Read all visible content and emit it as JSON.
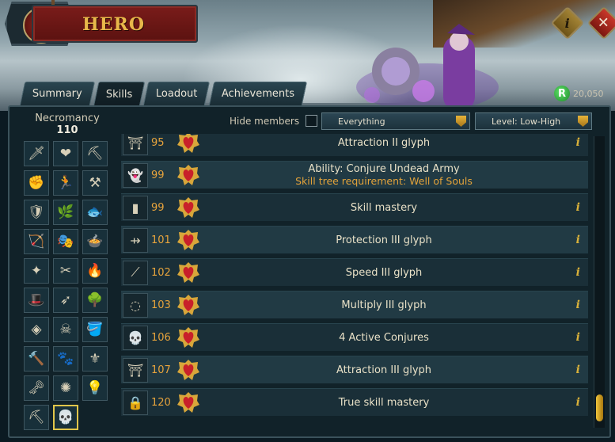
{
  "header": {
    "title": "HERO",
    "info_label": "i",
    "close_label": "✕"
  },
  "tabs": [
    {
      "label": "Summary"
    },
    {
      "label": "Skills"
    },
    {
      "label": "Loadout"
    },
    {
      "label": "Achievements"
    }
  ],
  "currency": {
    "icon_label": "R",
    "amount": "20,050"
  },
  "skill_panel": {
    "name": "Necromancy",
    "level": "110"
  },
  "filters": {
    "hide_members_label": "Hide members",
    "hide_members_checked": false,
    "category": "Everything",
    "sort": "Level: Low-High"
  },
  "skills": [
    {
      "icon": "attack-sword-icon",
      "glyph": "🗡"
    },
    {
      "icon": "constitution-heart-icon",
      "glyph": "❤"
    },
    {
      "icon": "mining-pickaxe-icon",
      "glyph": "⛏"
    },
    {
      "icon": "strength-fist-icon",
      "glyph": "✊"
    },
    {
      "icon": "agility-runner-icon",
      "glyph": "🏃"
    },
    {
      "icon": "smithing-anvil-icon",
      "glyph": "⚒"
    },
    {
      "icon": "defence-shield-icon",
      "glyph": "🛡"
    },
    {
      "icon": "herblore-leaf-icon",
      "glyph": "🌿"
    },
    {
      "icon": "fishing-fish-icon",
      "glyph": "🐟"
    },
    {
      "icon": "ranged-bow-icon",
      "glyph": "🏹"
    },
    {
      "icon": "thieving-mask-icon",
      "glyph": "🎭"
    },
    {
      "icon": "cooking-pot-icon",
      "glyph": "🍲"
    },
    {
      "icon": "prayer-star-icon",
      "glyph": "✦"
    },
    {
      "icon": "crafting-chisel-icon",
      "glyph": "✂"
    },
    {
      "icon": "firemaking-fire-icon",
      "glyph": "🔥"
    },
    {
      "icon": "magic-hat-icon",
      "glyph": "🎩"
    },
    {
      "icon": "fletching-arrow-icon",
      "glyph": "➶"
    },
    {
      "icon": "woodcutting-tree-icon",
      "glyph": "🌳"
    },
    {
      "icon": "runecrafting-rune-icon",
      "glyph": "◈"
    },
    {
      "icon": "slayer-skull-icon",
      "glyph": "☠"
    },
    {
      "icon": "farming-can-icon",
      "glyph": "🪣"
    },
    {
      "icon": "construction-hammer-icon",
      "glyph": "🔨"
    },
    {
      "icon": "hunter-paw-icon",
      "glyph": "🐾"
    },
    {
      "icon": "summoning-pouch-icon",
      "glyph": "⚜"
    },
    {
      "icon": "dungeoneering-key-icon",
      "glyph": "🗝"
    },
    {
      "icon": "divination-orb-icon",
      "glyph": "✺"
    },
    {
      "icon": "invention-bulb-icon",
      "glyph": "💡"
    },
    {
      "icon": "archaeology-brush-icon",
      "glyph": "⛏"
    },
    {
      "icon": "necromancy-skull-icon",
      "glyph": "💀"
    }
  ],
  "unlocks": [
    {
      "level": "95",
      "title": "Attraction II glyph",
      "req": "",
      "icon": "glyph-icon",
      "glyph": "⛩",
      "info": "i"
    },
    {
      "level": "99",
      "title": "Ability: Conjure Undead Army",
      "req": "Skill tree requirement: Well of Souls",
      "icon": "conjure-army-icon",
      "glyph": "👻",
      "info": ""
    },
    {
      "level": "99",
      "title": "Skill mastery",
      "req": "",
      "icon": "cape-icon",
      "glyph": "▮",
      "info": "i"
    },
    {
      "level": "101",
      "title": "Protection III glyph",
      "req": "",
      "icon": "glyph-icon",
      "glyph": "⇸",
      "info": "i"
    },
    {
      "level": "102",
      "title": "Speed III glyph",
      "req": "",
      "icon": "glyph-icon",
      "glyph": "⟋",
      "info": "i"
    },
    {
      "level": "103",
      "title": "Multiply III glyph",
      "req": "",
      "icon": "glyph-icon",
      "glyph": "◌",
      "info": "i"
    },
    {
      "level": "106",
      "title": "4 Active Conjures",
      "req": "",
      "icon": "skull-icon",
      "glyph": "💀",
      "info": "i"
    },
    {
      "level": "107",
      "title": "Attraction III glyph",
      "req": "",
      "icon": "glyph-icon",
      "glyph": "⛩",
      "info": "i"
    },
    {
      "level": "120",
      "title": "True skill mastery",
      "req": "",
      "icon": "lock-icon",
      "glyph": "🔒",
      "info": "i"
    }
  ],
  "colors": {
    "accent_gold": "#e8b84a",
    "level_orange": "#e8a43c",
    "panel_bg": "#112229"
  }
}
